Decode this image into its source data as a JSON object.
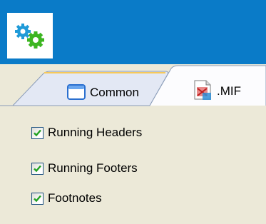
{
  "window": {
    "app_icon": "gears-icon",
    "accent_color": "#0a7bc8"
  },
  "tabs": [
    {
      "label": "Common",
      "icon": "window-icon",
      "selected": false
    },
    {
      "label": ".MIF",
      "icon": "mif-file-icon",
      "selected": true
    }
  ],
  "options": [
    {
      "label": "Running Headers",
      "checked": true
    },
    {
      "label": "Running Footers",
      "checked": true
    },
    {
      "label": "Footnotes",
      "checked": true
    }
  ]
}
